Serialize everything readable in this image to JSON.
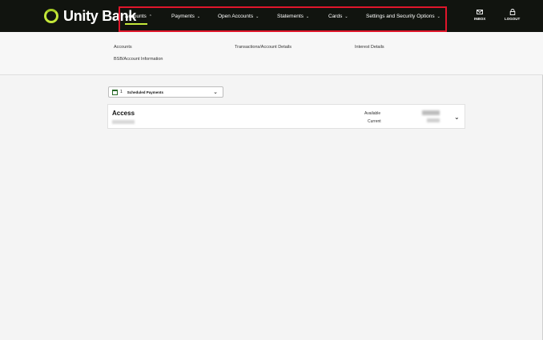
{
  "brand": {
    "name": "Unity Bank",
    "accent": "#c4e83a",
    "highlight": "#e0162b"
  },
  "nav": {
    "items": [
      {
        "label": "Accounts",
        "chev": "⌃"
      },
      {
        "label": "Payments",
        "chev": "⌄"
      },
      {
        "label": "Open Accounts",
        "chev": "⌄"
      },
      {
        "label": "Statements",
        "chev": "⌄"
      },
      {
        "label": "Cards",
        "chev": "⌄"
      },
      {
        "label": "Settings and Security Options",
        "chev": "⌄"
      }
    ],
    "inbox": "INBOX",
    "logout": "LOGOUT"
  },
  "submenu": {
    "links": [
      "Accounts",
      "Transactions/Account Details",
      "Interest Details",
      "BSB/Account Information"
    ]
  },
  "scheduled": {
    "count": "1",
    "label": "Scheduled Payments"
  },
  "account": {
    "name": "Access",
    "available_label": "Available",
    "current_label": "Current"
  }
}
